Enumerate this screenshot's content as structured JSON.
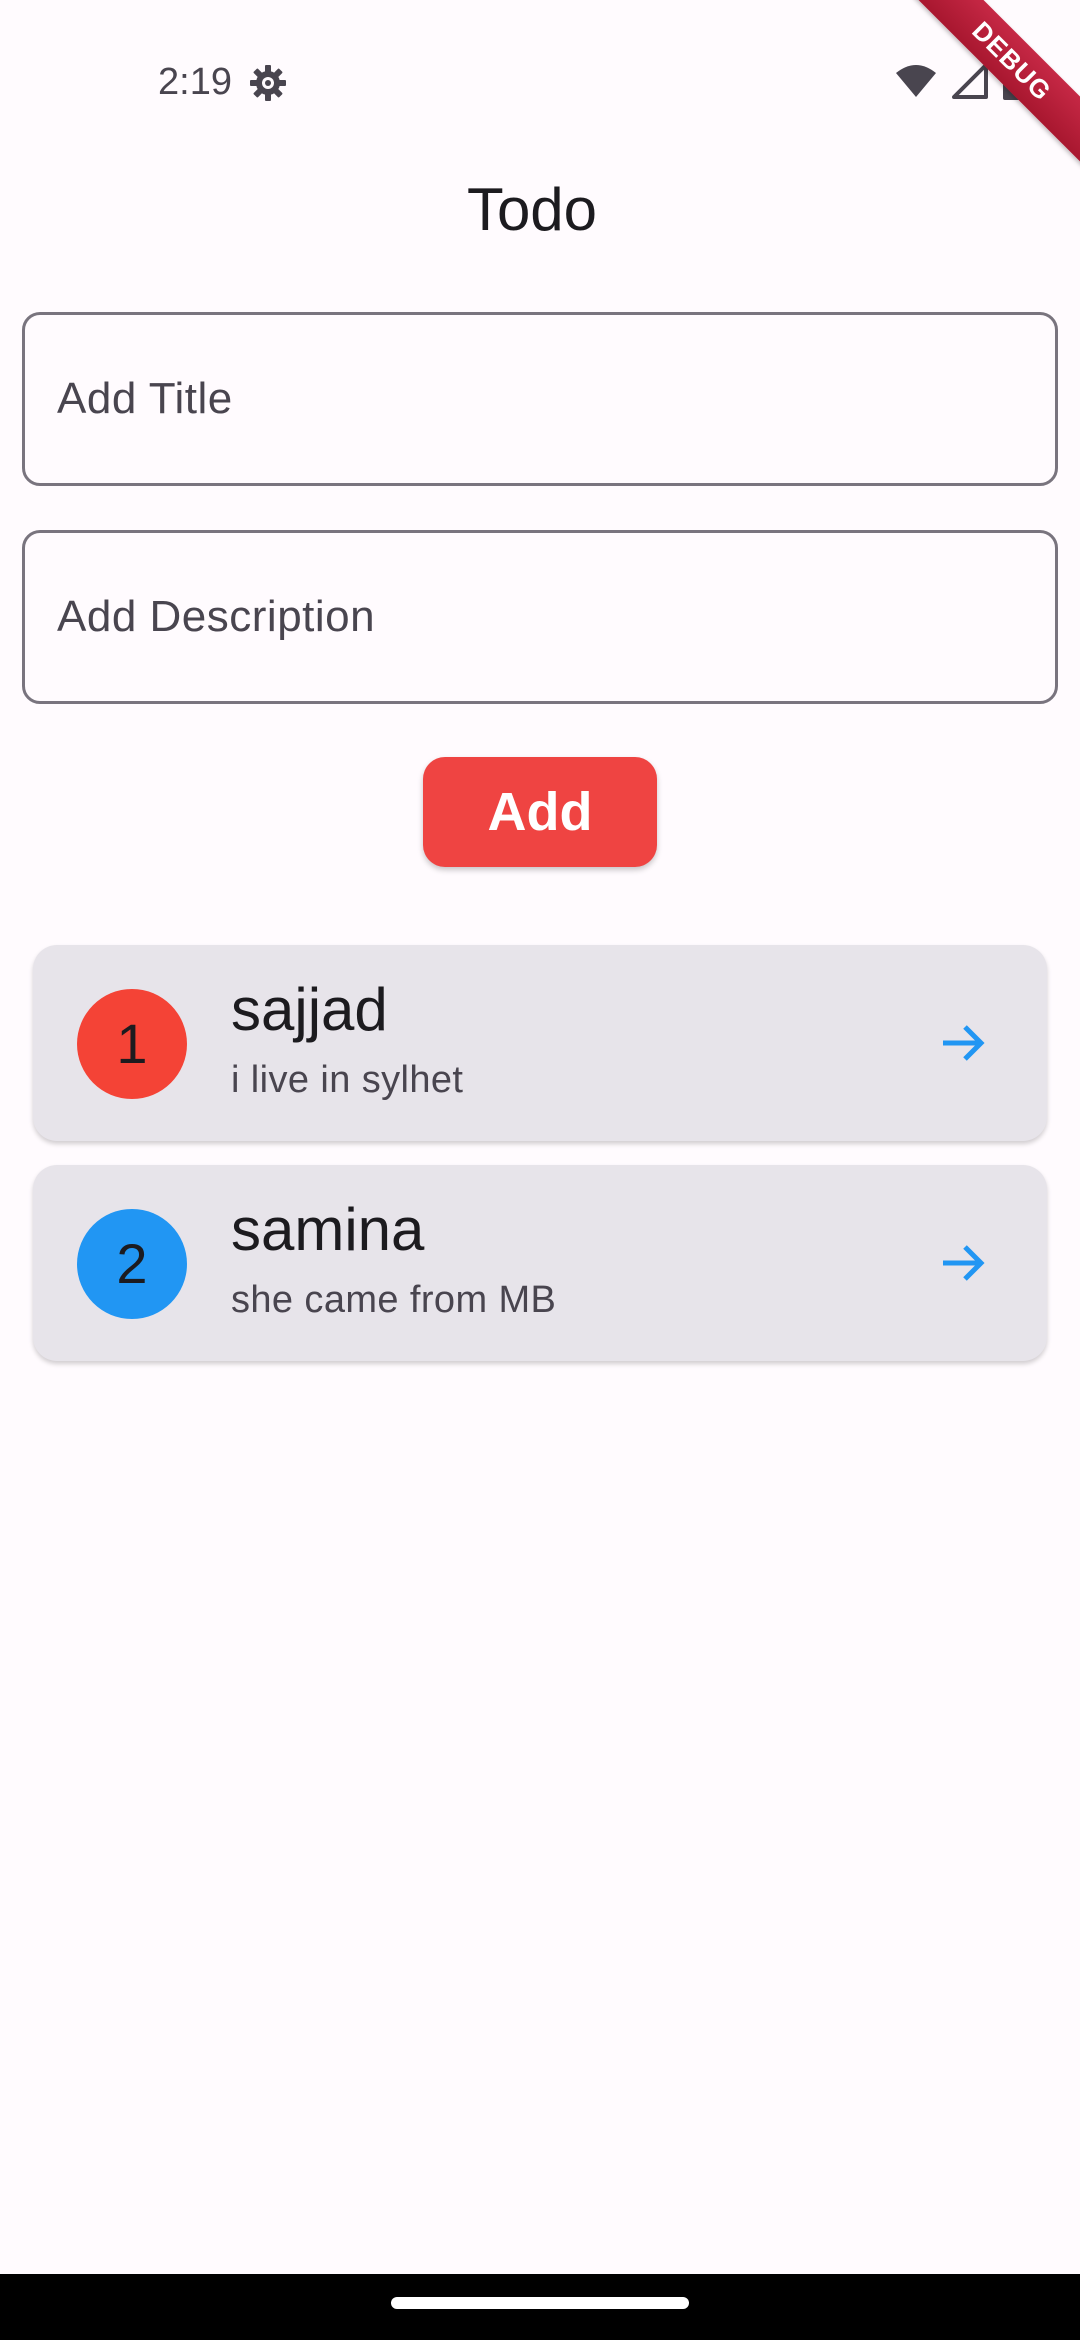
{
  "status_bar": {
    "time": "2:19",
    "icons": [
      "gear-icon",
      "wifi-icon",
      "signal-icon",
      "battery-icon"
    ]
  },
  "debug_banner": {
    "label": "DEBUG",
    "color": "#b71c3a"
  },
  "app_bar": {
    "title": "Todo"
  },
  "form": {
    "title_field": {
      "value": "",
      "placeholder": "Add Title"
    },
    "description_field": {
      "value": "",
      "placeholder": "Add Description"
    },
    "add_button": {
      "label": "Add",
      "color": "#ef4442"
    }
  },
  "todos": [
    {
      "index": "1",
      "title": "sajjad",
      "description": "i live in sylhet",
      "avatar_color": "#f44336",
      "action_icon": "arrow-forward-icon"
    },
    {
      "index": "2",
      "title": "samina",
      "description": "she came from MB",
      "avatar_color": "#2196f3",
      "action_icon": "arrow-forward-icon"
    }
  ],
  "colors": {
    "background": "#fffbfe",
    "card": "#e7e4ea",
    "accent_arrow": "#2196f3"
  }
}
